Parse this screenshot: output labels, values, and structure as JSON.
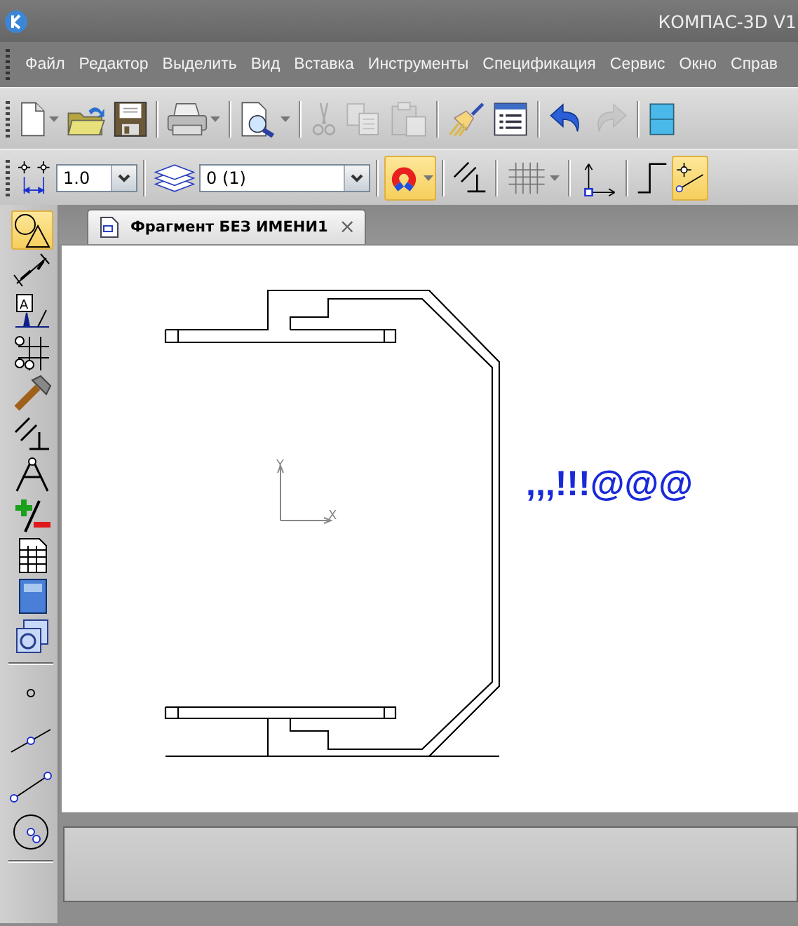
{
  "window": {
    "title": "КОМПАС-3D V1"
  },
  "menu": [
    {
      "label": "Файл"
    },
    {
      "label": "Редактор"
    },
    {
      "label": "Выделить"
    },
    {
      "label": "Вид"
    },
    {
      "label": "Вставка"
    },
    {
      "label": "Инструменты"
    },
    {
      "label": "Спецификация"
    },
    {
      "label": "Сервис"
    },
    {
      "label": "Окно"
    },
    {
      "label": "Справ"
    }
  ],
  "toolbar": [
    {
      "kind": "button",
      "dropdown": true,
      "disabled": false
    },
    {
      "kind": "button",
      "dropdown": false,
      "disabled": false
    },
    {
      "kind": "button",
      "dropdown": false,
      "disabled": false
    },
    {
      "kind": "separator"
    },
    {
      "kind": "button",
      "dropdown": true,
      "disabled": false
    },
    {
      "kind": "separator"
    },
    {
      "kind": "button",
      "dropdown": true,
      "disabled": false
    },
    {
      "kind": "separator"
    },
    {
      "kind": "button",
      "dropdown": false,
      "disabled": true
    },
    {
      "kind": "button",
      "dropdown": false,
      "disabled": true
    },
    {
      "kind": "button",
      "dropdown": false,
      "disabled": true
    },
    {
      "kind": "separator"
    },
    {
      "kind": "button",
      "dropdown": false,
      "disabled": false
    },
    {
      "kind": "button",
      "dropdown": false,
      "disabled": false
    },
    {
      "kind": "separator"
    },
    {
      "kind": "button",
      "dropdown": false,
      "disabled": false
    },
    {
      "kind": "button",
      "dropdown": false,
      "disabled": true
    },
    {
      "kind": "separator"
    },
    {
      "kind": "button",
      "dropdown": false,
      "disabled": false
    }
  ],
  "toolbar_2": [
    {
      "kind": "button",
      "on": false,
      "dropdown": false
    },
    {
      "kind": "field",
      "value": "1.0"
    },
    {
      "kind": "separator"
    },
    {
      "kind": "button",
      "on": false,
      "dropdown": false
    },
    {
      "kind": "field",
      "value": "0 (1)"
    },
    {
      "kind": "separator"
    },
    {
      "kind": "button",
      "on": true,
      "dropdown": true
    },
    {
      "kind": "separator"
    },
    {
      "kind": "button",
      "on": false,
      "dropdown": false
    },
    {
      "kind": "separator"
    },
    {
      "kind": "button",
      "on": false,
      "dropdown": true
    },
    {
      "kind": "separator"
    },
    {
      "kind": "button",
      "on": false,
      "dropdown": false
    },
    {
      "kind": "separator"
    },
    {
      "kind": "button",
      "on": false,
      "dropdown": false
    },
    {
      "kind": "button",
      "on": true,
      "dropdown": false
    }
  ],
  "tools_panel": [
    {
      "selected": true
    },
    {
      "selected": false
    },
    {
      "selected": false,
      "label": "A"
    },
    {
      "selected": false
    },
    {
      "selected": false
    },
    {
      "selected": false
    },
    {
      "selected": false
    },
    {
      "selected": false
    },
    {
      "selected": false
    },
    {
      "selected": false
    },
    {
      "selected": false
    }
  ],
  "document_tab": {
    "title": "Фрагмент БЕЗ ИМЕНИ1",
    "close": "×"
  },
  "canvas": {
    "axis_y": "Y",
    "axis_x": "X",
    "text": ",,,!!!@@@"
  }
}
